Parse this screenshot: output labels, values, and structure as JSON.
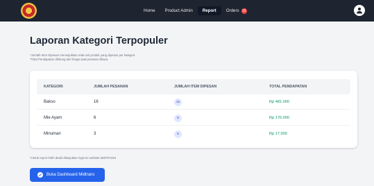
{
  "nav": {
    "links": [
      {
        "label": "Home"
      },
      {
        "label": "Product Admin"
      },
      {
        "label": "Report"
      },
      {
        "label": "Orders"
      }
    ],
    "active": "Report",
    "orders_badge": "10"
  },
  "page": {
    "title": "Laporan Kategori Terpopuler",
    "notes": [
      "*Jumlah Item Dipesan menunjukkan total unit produk yang dipesan per kategori.",
      "*Total Pendapatan dihitung dari harga saat pesanan dibuat."
    ]
  },
  "table": {
    "columns": [
      "KATEGORI",
      "JUMLAH PESANAN",
      "JUMLAH ITEM DIPESAN",
      "TOTAL PENDAPATAN"
    ],
    "rows": [
      {
        "category": "Bakso",
        "orders": "16",
        "items": "31",
        "income": "Rp 481.000"
      },
      {
        "category": "Mie Ayam",
        "orders": "6",
        "items": "9",
        "income": "Rp 176.000"
      },
      {
        "category": "Minuman",
        "orders": "3",
        "items": "5",
        "income": "Rp 17.000"
      }
    ]
  },
  "footer": {
    "note": "*Untuk report lebih detail dilanjutkan login ke website MIDTRANS",
    "button_label": "Buka Dashboard Midtrans"
  },
  "colors": {
    "navbar": "#1e2530",
    "primary": "#2563eb",
    "income": "#059669",
    "pill_bg": "#e0e7ff",
    "badge": "#ef4444"
  }
}
